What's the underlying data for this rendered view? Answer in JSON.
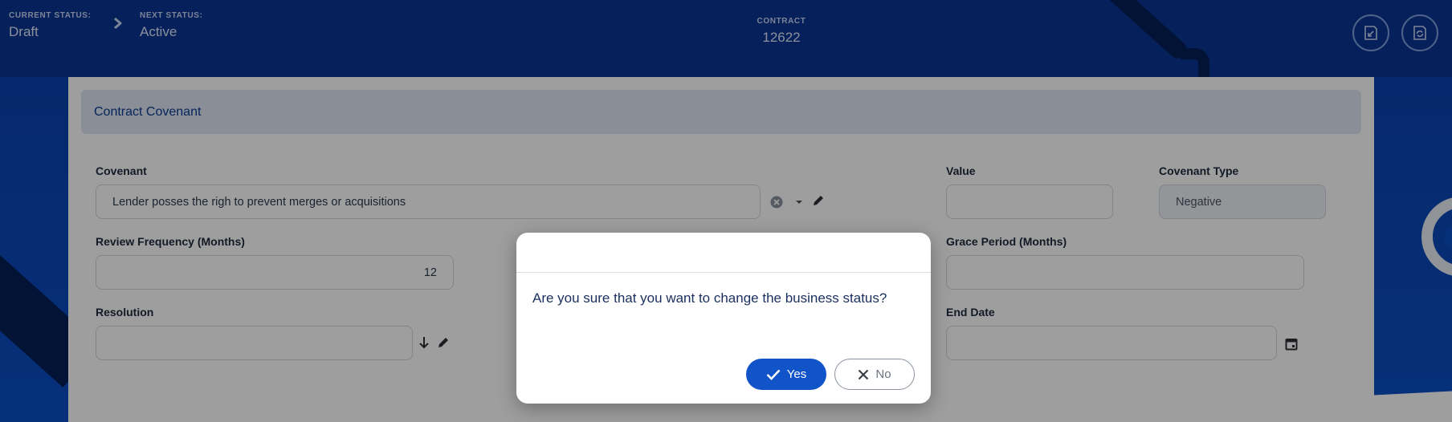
{
  "header": {
    "current_status_label": "CURRENT STATUS:",
    "current_status_value": "Draft",
    "next_status_label": "NEXT STATUS:",
    "next_status_value": "Active",
    "contract_label": "CONTRACT",
    "contract_value": "12622"
  },
  "section": {
    "title": "Contract Covenant"
  },
  "form": {
    "covenant_label": "Covenant",
    "covenant_value": "Lender posses the righ to prevent merges or acquisitions",
    "value_label": "Value",
    "value_value": "",
    "covenant_type_label": "Covenant Type",
    "covenant_type_value": "Negative",
    "review_frequency_label": "Review Frequency (Months)",
    "review_frequency_value": "12",
    "grace_period_label": "Grace Period (Months)",
    "grace_period_value": "",
    "resolution_label": "Resolution",
    "resolution_value": "",
    "end_date_label": "End Date",
    "end_date_value": ""
  },
  "dialog": {
    "message": "Are you sure that you want to change the business status?",
    "yes_label": "Yes",
    "no_label": "No"
  },
  "colors": {
    "brand_blue": "#0b4fc6",
    "dark_navy": "#061f57",
    "primary_button": "#1153c9"
  }
}
